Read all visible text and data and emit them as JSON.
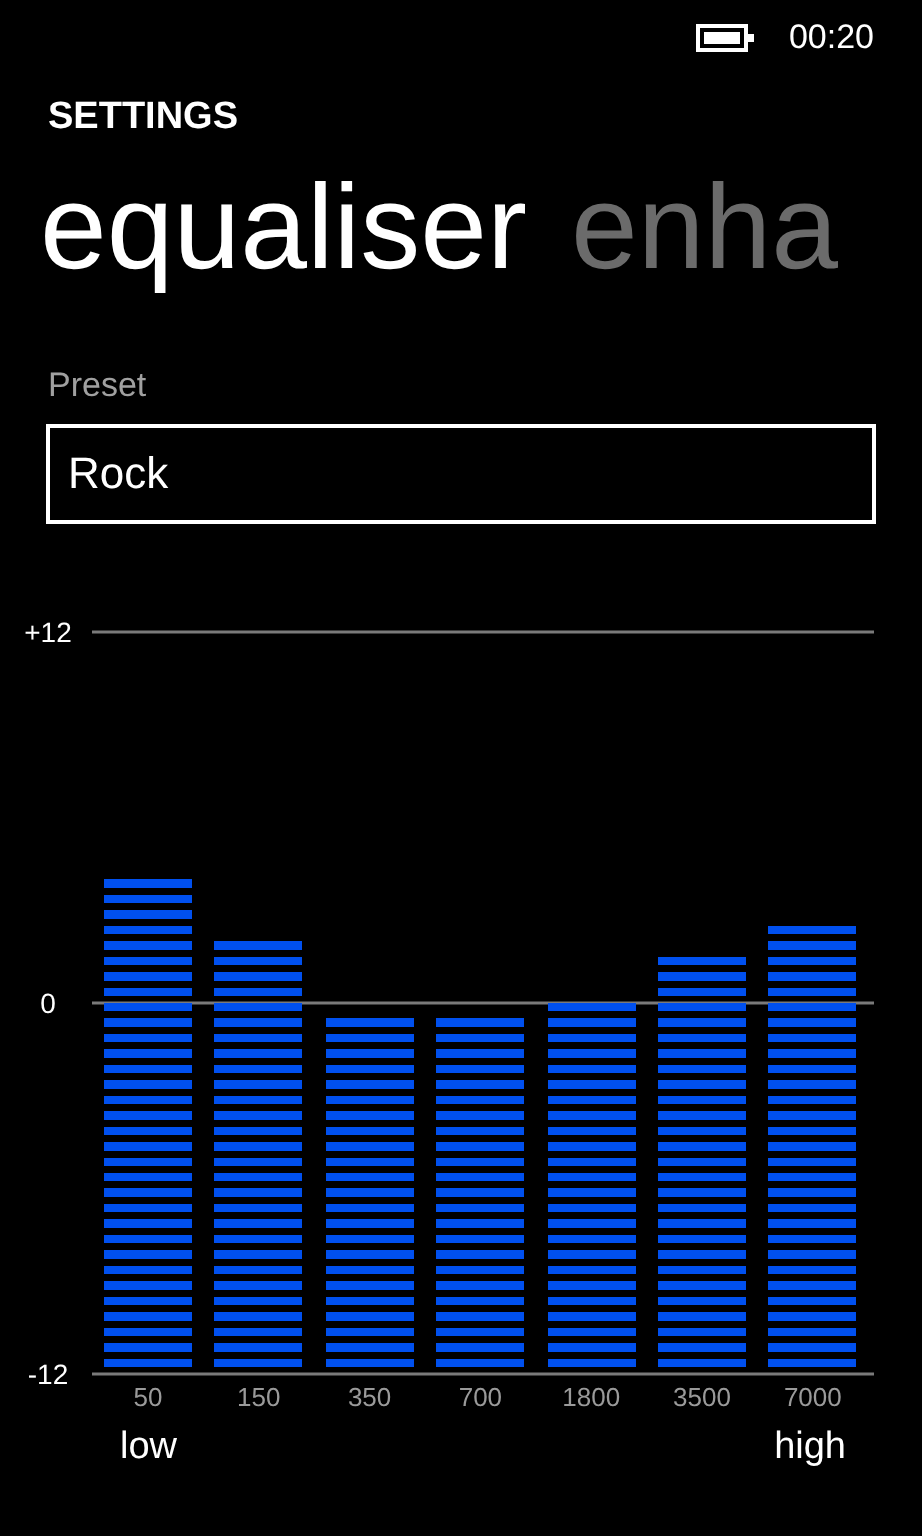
{
  "status_bar": {
    "time": "00:20"
  },
  "header": {
    "title": "SETTINGS"
  },
  "pivot": [
    {
      "label": "equaliser",
      "selected": true
    },
    {
      "label": "enha",
      "selected": false
    }
  ],
  "preset": {
    "label": "Preset",
    "value": "Rock"
  },
  "equaliser": {
    "scale": [
      "+12",
      "0",
      "-12"
    ],
    "bands": [
      {
        "label": "50",
        "level": 0.667
      },
      {
        "label": "150",
        "level": 0.583
      },
      {
        "label": "350",
        "level": 0.479
      },
      {
        "label": "700",
        "level": 0.479
      },
      {
        "label": "1800",
        "level": 0.5
      },
      {
        "label": "3500",
        "level": 0.5625
      },
      {
        "label": "7000",
        "level": 0.604
      }
    ],
    "range_low": "low",
    "range_high": "high"
  }
}
